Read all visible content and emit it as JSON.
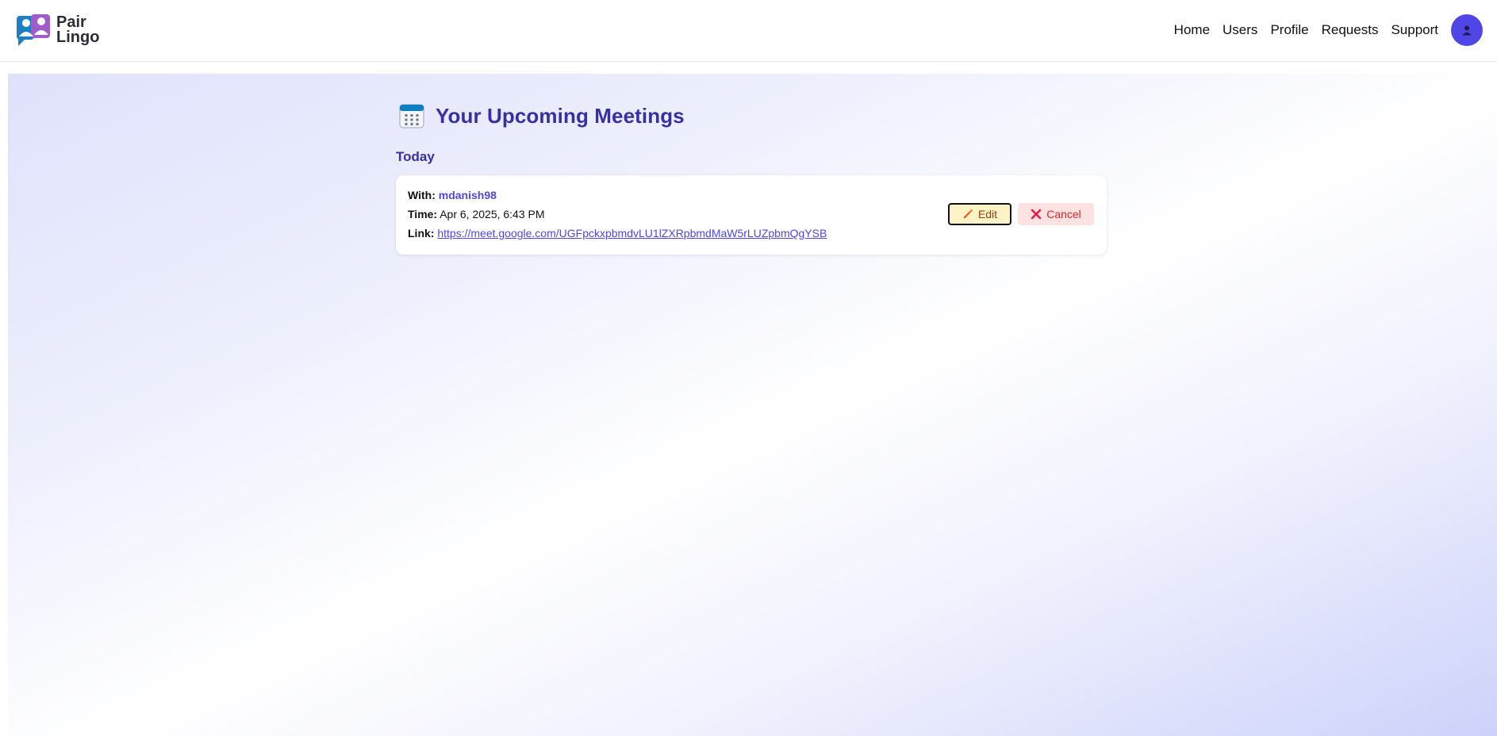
{
  "brand": {
    "line1": "Pair",
    "line2": "Lingo"
  },
  "nav": {
    "items": [
      "Home",
      "Users",
      "Profile",
      "Requests",
      "Support"
    ],
    "avatar_icon": "user-icon"
  },
  "page": {
    "title": "Your Upcoming Meetings",
    "title_icon": "calendar-icon",
    "group_label": "Today"
  },
  "meeting": {
    "with_label": "With:",
    "with_value": "mdanish98",
    "time_label": "Time:",
    "time_value": "Apr 6, 2025, 6:43 PM",
    "link_label": "Link:",
    "link_value": "https://meet.google.com/UGFpckxpbmdvLU1lZXRpbmdMaW5rLUZpbmQgYSB",
    "edit_label": "Edit",
    "cancel_label": "Cancel"
  },
  "colors": {
    "accent": "#4f46e5",
    "title": "#3730a3",
    "edit_bg": "#fef3c7",
    "cancel_bg": "#fee2e2",
    "cancel_text": "#dc2626"
  }
}
